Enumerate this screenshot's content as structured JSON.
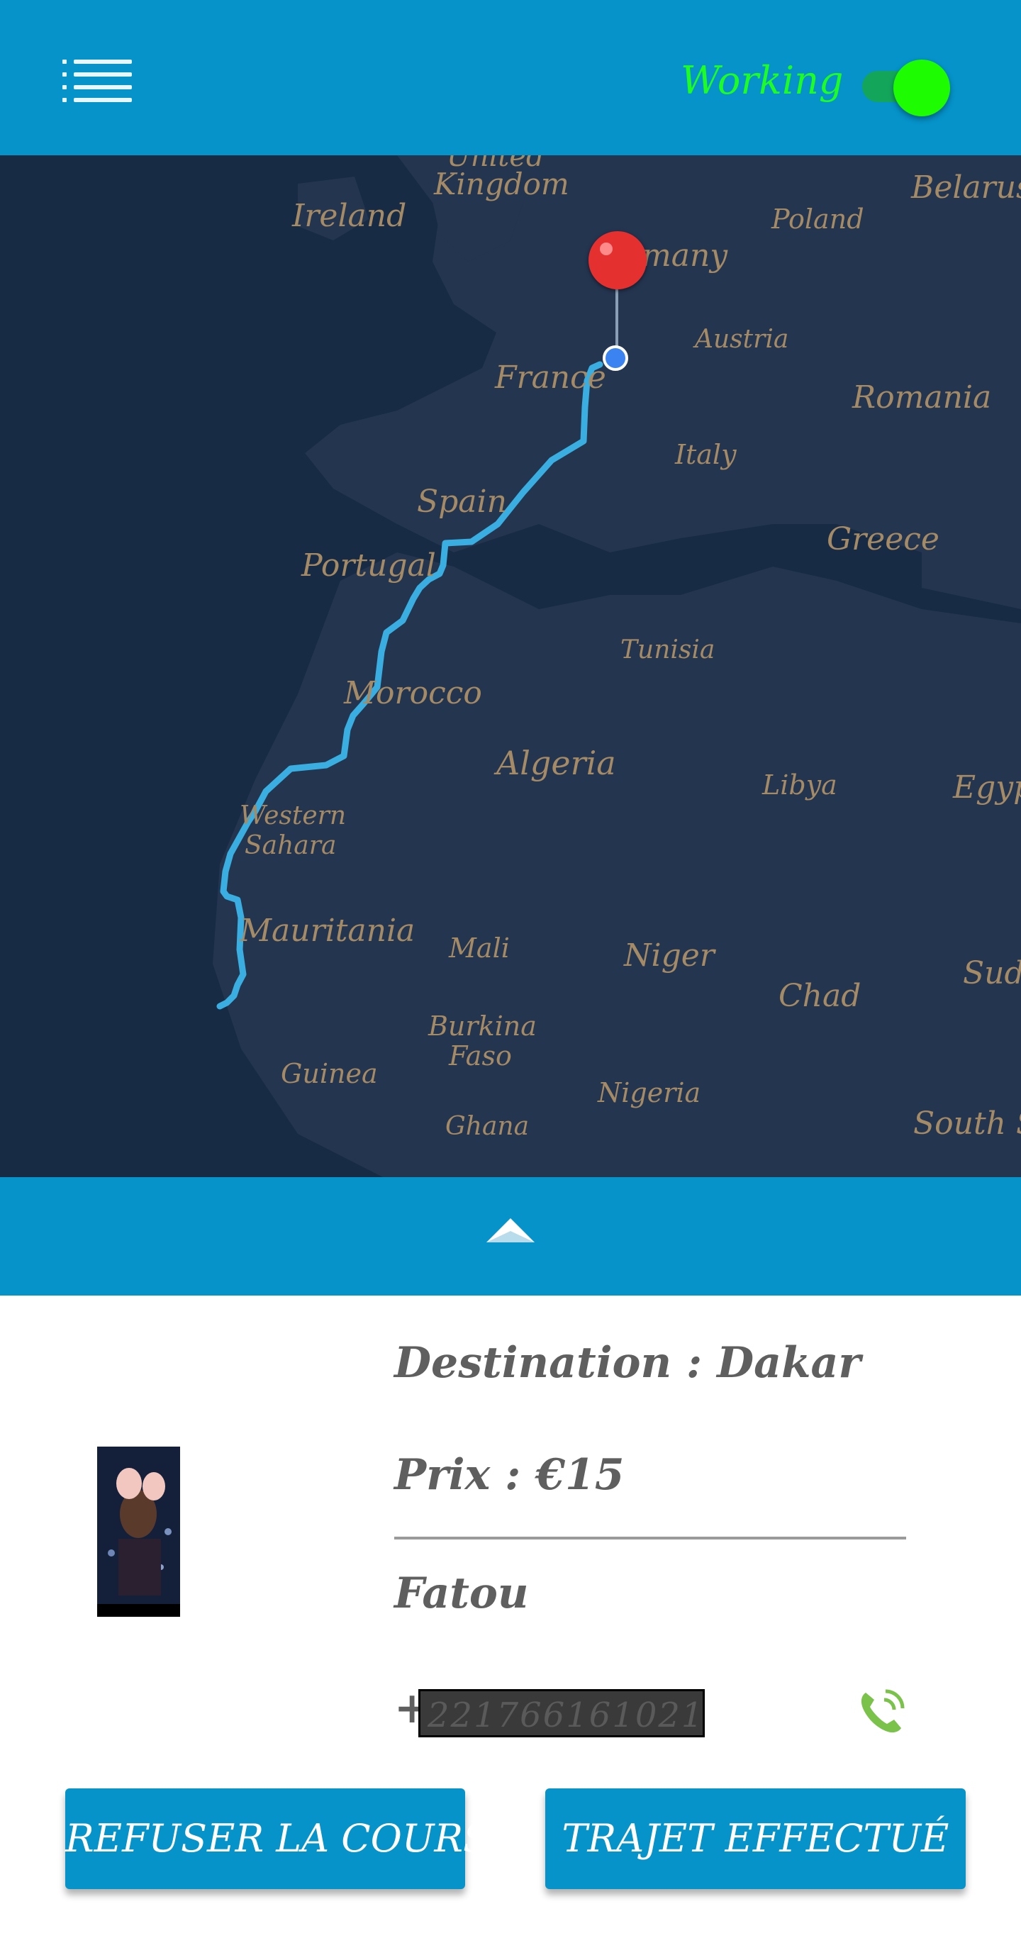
{
  "header": {
    "menu_icon": "hamburger-menu-icon",
    "status_label": "Working",
    "status_toggle_on": true,
    "colors": {
      "bar": "#0593c9",
      "status": "#1dfc24",
      "toggle_knob": "#1dfc00"
    }
  },
  "map": {
    "labels": {
      "united_kingdom_top": "United",
      "united_kingdom": "Kingdom",
      "ireland": "Ireland",
      "poland": "Poland",
      "belarus": "Belarus",
      "germany": "many",
      "austria": "Austria",
      "france": "France",
      "romania": "Romania",
      "italy": "Italy",
      "spain": "Spain",
      "greece": "Greece",
      "portugal": "Portugal",
      "tunisia": "Tunisia",
      "morocco": "Morocco",
      "algeria": "Algeria",
      "libya": "Libya",
      "egypt": "Egyp",
      "western_sahara_1": "Western",
      "western_sahara_2": "Sahara",
      "mauritania": "Mauritania",
      "mali": "Mali",
      "niger": "Niger",
      "chad": "Chad",
      "sudan": "Sude",
      "burkina_1": "Burkina",
      "burkina_2": "Faso",
      "guinea": "Guinea",
      "nigeria": "Nigeria",
      "ghana": "Ghana",
      "south_sudan": "South Su"
    },
    "route_color": "#3aaee0",
    "pin_color": "#e53030",
    "location_color": "#3b83f0"
  },
  "expand": {
    "icon": "chevron-up-icon"
  },
  "ride": {
    "destination": "Destination : Dakar",
    "price": "Prix : €15",
    "client_name": "Fatou",
    "phone_prefix": "+",
    "phone_redacted": "221766161021",
    "call_icon": "phone-call-icon"
  },
  "actions": {
    "refuse_label": "REFUSER LA COURSE",
    "done_label": "TRAJET EFFECTUÉ"
  }
}
